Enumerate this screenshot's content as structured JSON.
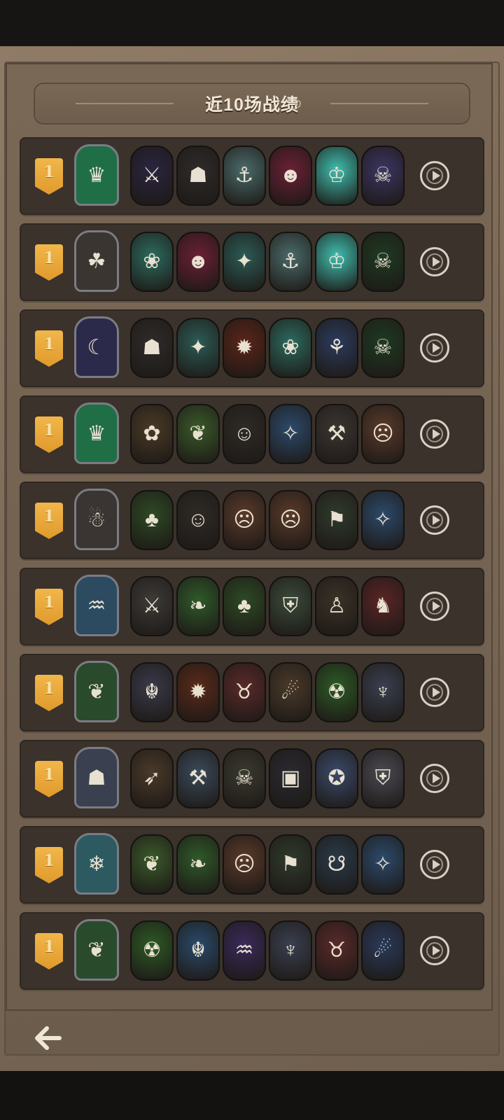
{
  "header": {
    "title": "近10场战绩"
  },
  "colors": {
    "rank_badge": "#e9a637",
    "panel": "#3a322b",
    "parchment": "#7c6a57"
  },
  "matches": [
    {
      "rank": "1",
      "hero": {
        "name": "thorn-queen-icon",
        "glyph": "♛",
        "bg": "#1f6e46"
      },
      "units": [
        {
          "name": "dark-knight-icon",
          "glyph": "⚔",
          "bg": "#2a2540"
        },
        {
          "name": "hooded-reaper-icon",
          "glyph": "☗",
          "bg": "#2f2b2a"
        },
        {
          "name": "sea-captain-icon",
          "glyph": "⚓",
          "bg": "#4a6b6a"
        },
        {
          "name": "jester-clown-icon",
          "glyph": "☻",
          "bg": "#6b2035"
        },
        {
          "name": "ghost-king-icon",
          "glyph": "♔",
          "bg": "#3fbfb0"
        },
        {
          "name": "pumpkin-lord-icon",
          "glyph": "☠",
          "bg": "#3b3563"
        }
      ]
    },
    {
      "rank": "1",
      "hero": {
        "name": "rat-thief-icon",
        "glyph": "☘",
        "bg": "#3a3530"
      },
      "units": [
        {
          "name": "red-haired-maiden-icon",
          "glyph": "❀",
          "bg": "#2c6b5e"
        },
        {
          "name": "jester-clown-icon",
          "glyph": "☻",
          "bg": "#6b2035"
        },
        {
          "name": "pirate-girl-icon",
          "glyph": "✦",
          "bg": "#2c5b55"
        },
        {
          "name": "sea-captain-icon",
          "glyph": "⚓",
          "bg": "#4a6b6a"
        },
        {
          "name": "ghost-king-icon",
          "glyph": "♔",
          "bg": "#3fbfb0"
        },
        {
          "name": "skull-lich-icon",
          "glyph": "☠",
          "bg": "#1f3a23"
        }
      ]
    },
    {
      "rank": "1",
      "hero": {
        "name": "shadow-bat-icon",
        "glyph": "☾",
        "bg": "#2b2a4a"
      },
      "units": [
        {
          "name": "hooded-reaper-icon",
          "glyph": "☗",
          "bg": "#2f2b2a"
        },
        {
          "name": "pirate-girl-icon",
          "glyph": "✦",
          "bg": "#2c5b55"
        },
        {
          "name": "fire-demon-icon",
          "glyph": "✹",
          "bg": "#5a2518"
        },
        {
          "name": "red-haired-maiden-icon",
          "glyph": "❀",
          "bg": "#2c6b5e"
        },
        {
          "name": "witch-hat-icon",
          "glyph": "⚘",
          "bg": "#2b3b5c"
        },
        {
          "name": "skull-lich-icon",
          "glyph": "☠",
          "bg": "#1f3a23"
        }
      ]
    },
    {
      "rank": "1",
      "hero": {
        "name": "thorn-queen-icon",
        "glyph": "♛",
        "bg": "#1f6e46"
      },
      "units": [
        {
          "name": "flower-dryad-icon",
          "glyph": "✿",
          "bg": "#4a3a26"
        },
        {
          "name": "leaf-sprout-icon",
          "glyph": "❦",
          "bg": "#3a5a2a"
        },
        {
          "name": "pumpkin-ghost-icon",
          "glyph": "☺",
          "bg": "#2e2a26"
        },
        {
          "name": "elf-sorceress-icon",
          "glyph": "✧",
          "bg": "#2c4a6b"
        },
        {
          "name": "bearded-warrior-icon",
          "glyph": "⚒",
          "bg": "#3c3632"
        },
        {
          "name": "tomato-brute-icon",
          "glyph": "☹",
          "bg": "#5a3a2a"
        }
      ]
    },
    {
      "rank": "1",
      "hero": {
        "name": "grey-goblin-icon",
        "glyph": "☃",
        "bg": "#3a3532"
      },
      "units": [
        {
          "name": "treant-icon",
          "glyph": "♣",
          "bg": "#2d4a25"
        },
        {
          "name": "pumpkin-ghost-icon",
          "glyph": "☺",
          "bg": "#2e2a26"
        },
        {
          "name": "tomato-brute-icon",
          "glyph": "☹",
          "bg": "#5a3a2a"
        },
        {
          "name": "tomato-brute-icon",
          "glyph": "☹",
          "bg": "#5a3a2a"
        },
        {
          "name": "scarecrow-icon",
          "glyph": "⚑",
          "bg": "#2f3a2c"
        },
        {
          "name": "elf-sorceress-icon",
          "glyph": "✧",
          "bg": "#2c4a6b"
        }
      ]
    },
    {
      "rank": "1",
      "hero": {
        "name": "blue-mermaid-icon",
        "glyph": "♒",
        "bg": "#2c4a60"
      },
      "units": [
        {
          "name": "armored-orc-icon",
          "glyph": "⚔",
          "bg": "#3d3a38"
        },
        {
          "name": "leaf-spirit-icon",
          "glyph": "❧",
          "bg": "#2f5a2a"
        },
        {
          "name": "treant-icon",
          "glyph": "♣",
          "bg": "#2d4a25"
        },
        {
          "name": "green-knight-icon",
          "glyph": "⛨",
          "bg": "#3a4a3a"
        },
        {
          "name": "puppet-boy-icon",
          "glyph": "♙",
          "bg": "#3a3228"
        },
        {
          "name": "horned-knight-icon",
          "glyph": "♞",
          "bg": "#5a2525"
        }
      ]
    },
    {
      "rank": "1",
      "hero": {
        "name": "leaf-witch-icon",
        "glyph": "❦",
        "bg": "#2a4a2c"
      },
      "units": [
        {
          "name": "grey-dragon-icon",
          "glyph": "☬",
          "bg": "#3a3a4a"
        },
        {
          "name": "lava-beast-icon",
          "glyph": "✹",
          "bg": "#5a2a1a"
        },
        {
          "name": "red-imp-icon",
          "glyph": "♉",
          "bg": "#5a2a2a"
        },
        {
          "name": "cowboy-gunner-icon",
          "glyph": "☄",
          "bg": "#4a3a2a"
        },
        {
          "name": "green-goblin-icon",
          "glyph": "☢",
          "bg": "#2d5a25"
        },
        {
          "name": "winged-gargoyle-icon",
          "glyph": "♆",
          "bg": "#3a4050"
        }
      ]
    },
    {
      "rank": "1",
      "hero": {
        "name": "stone-golem-icon",
        "glyph": "☗",
        "bg": "#3a4050"
      },
      "units": [
        {
          "name": "archer-hunter-icon",
          "glyph": "➶",
          "bg": "#4a3a2a"
        },
        {
          "name": "lumberjack-icon",
          "glyph": "⚒",
          "bg": "#3a4a5a"
        },
        {
          "name": "bandit-icon",
          "glyph": "☠",
          "bg": "#3a3a30"
        },
        {
          "name": "iron-maiden-icon",
          "glyph": "▣",
          "bg": "#2a2a30"
        },
        {
          "name": "blue-ninja-icon",
          "glyph": "✪",
          "bg": "#3a4a6a"
        },
        {
          "name": "paladin-helm-icon",
          "glyph": "⛨",
          "bg": "#4a4a52"
        }
      ]
    },
    {
      "rank": "1",
      "hero": {
        "name": "ice-fairy-icon",
        "glyph": "❄",
        "bg": "#2c5a60"
      },
      "units": [
        {
          "name": "leaf-sprout-icon",
          "glyph": "❦",
          "bg": "#3a5a2a"
        },
        {
          "name": "leaf-spirit-icon",
          "glyph": "❧",
          "bg": "#2f5a2a"
        },
        {
          "name": "tomato-brute-icon",
          "glyph": "☹",
          "bg": "#5a3a2a"
        },
        {
          "name": "scarecrow-icon",
          "glyph": "⚑",
          "bg": "#2f3a2c"
        },
        {
          "name": "green-troll-icon",
          "glyph": "☋",
          "bg": "#2a3a4a"
        },
        {
          "name": "elf-sorceress-icon",
          "glyph": "✧",
          "bg": "#2c4a6b"
        }
      ]
    },
    {
      "rank": "1",
      "hero": {
        "name": "leaf-witch-icon",
        "glyph": "❦",
        "bg": "#2a4a2c"
      },
      "units": [
        {
          "name": "green-goblin-icon",
          "glyph": "☢",
          "bg": "#2d5a25"
        },
        {
          "name": "blue-dragon-icon",
          "glyph": "☬",
          "bg": "#2a4a6a"
        },
        {
          "name": "purple-serpent-icon",
          "glyph": "♒",
          "bg": "#3a2a5a"
        },
        {
          "name": "winged-gargoyle-icon",
          "glyph": "♆",
          "bg": "#3a4050"
        },
        {
          "name": "red-imp-icon",
          "glyph": "♉",
          "bg": "#5a2a2a"
        },
        {
          "name": "gunslinger-icon",
          "glyph": "☄",
          "bg": "#2a3a5a"
        }
      ]
    }
  ],
  "footer": {
    "back_icon": "back-arrow-icon"
  }
}
